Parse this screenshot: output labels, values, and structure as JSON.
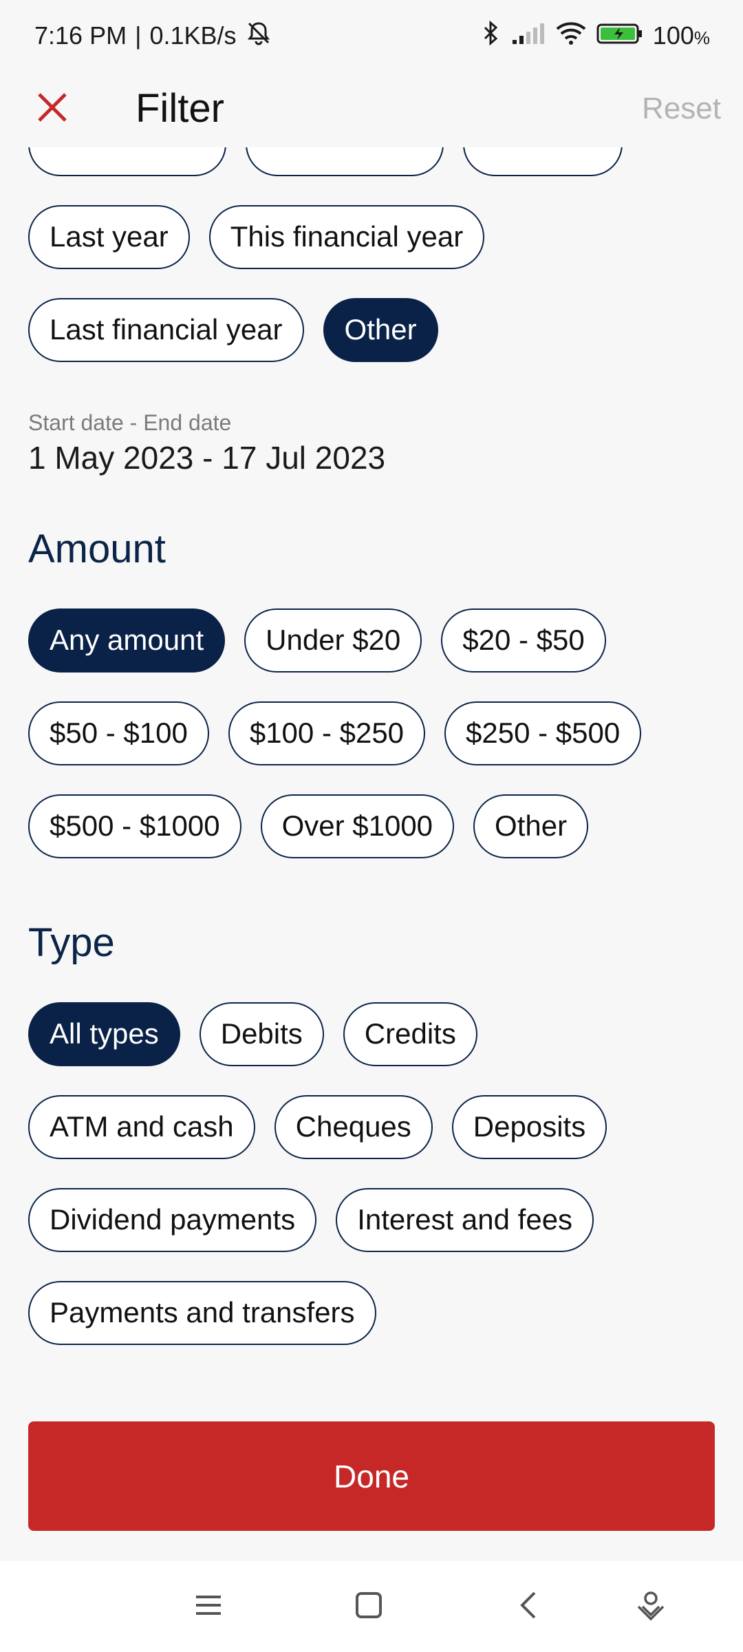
{
  "status_bar": {
    "time": "7:16 PM",
    "network_speed": "0.1KB/s",
    "battery": "100",
    "battery_unit": "%",
    "icons": [
      "mute-bell-icon",
      "bluetooth-icon",
      "signal-icon",
      "wifi-icon",
      "battery-charging-icon"
    ]
  },
  "header": {
    "title": "Filter",
    "reset_label": "Reset",
    "close_icon": "close-icon"
  },
  "date_range": {
    "row_partial": [
      "",
      "",
      ""
    ],
    "row1": [
      "Last year",
      "This financial year"
    ],
    "row2": [
      "Last financial year",
      "Other"
    ],
    "selected": "Other",
    "date_label": "Start date - End date",
    "date_value": "1 May 2023 - 17 Jul 2023"
  },
  "amount": {
    "heading": "Amount",
    "rows": [
      [
        "Any amount",
        "Under $20",
        "$20 - $50"
      ],
      [
        "$50 - $100",
        "$100 - $250",
        "$250 - $500"
      ],
      [
        "$500 - $1000",
        "Over $1000",
        "Other"
      ]
    ],
    "selected": "Any amount"
  },
  "type": {
    "heading": "Type",
    "rows": [
      [
        "All types",
        "Debits",
        "Credits"
      ],
      [
        "ATM and cash",
        "Cheques",
        "Deposits"
      ],
      [
        "Dividend payments",
        "Interest and fees"
      ],
      [
        "Payments and transfers"
      ]
    ],
    "selected": "All types"
  },
  "done_label": "Done",
  "nav_bar": {
    "items": [
      "menu-icon",
      "home-square-icon",
      "back-icon",
      "assistant-icon"
    ]
  },
  "colors": {
    "accent_navy": "#0a2248",
    "done_red": "#c62828",
    "close_red": "#c62828",
    "muted_gray": "#b3b3b3"
  }
}
